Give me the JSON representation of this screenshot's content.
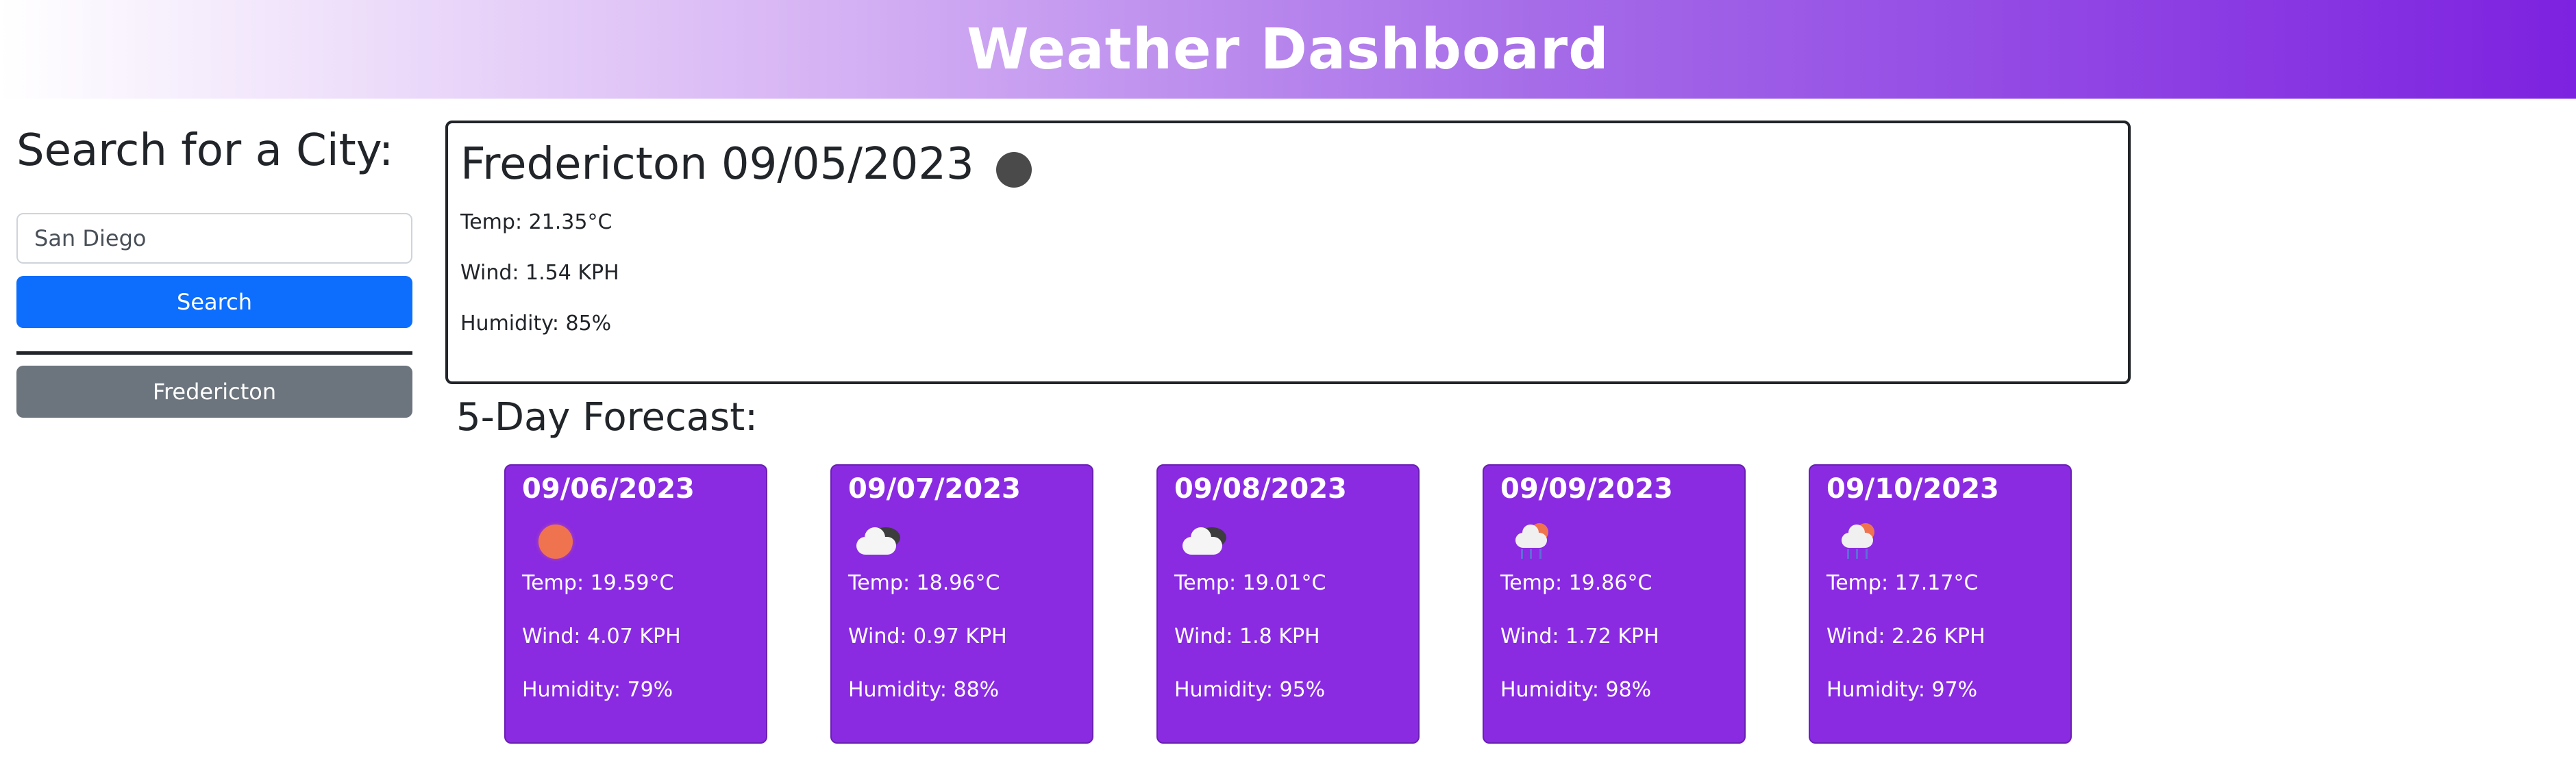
{
  "header": {
    "title": "Weather Dashboard"
  },
  "sidebar": {
    "search_title": "Search for a City:",
    "search_input_value": "San Diego",
    "search_button_label": "Search",
    "history": [
      "Fredericton"
    ]
  },
  "current": {
    "title": "Fredericton 09/05/2023",
    "icon": "overcast-cloud-icon",
    "temp": "Temp: 21.35°C",
    "wind": "Wind: 1.54 KPH",
    "humidity": "Humidity: 85%"
  },
  "forecast": {
    "title": "5-Day Forecast:",
    "days": [
      {
        "date": "09/06/2023",
        "icon": "clear-sun-icon",
        "temp": "Temp: 19.59°C",
        "wind": "Wind: 4.07 KPH",
        "humidity": "Humidity: 79%"
      },
      {
        "date": "09/07/2023",
        "icon": "broken-clouds-icon",
        "temp": "Temp: 18.96°C",
        "wind": "Wind: 0.97 KPH",
        "humidity": "Humidity: 88%"
      },
      {
        "date": "09/08/2023",
        "icon": "broken-clouds-icon",
        "temp": "Temp: 19.01°C",
        "wind": "Wind: 1.8 KPH",
        "humidity": "Humidity: 95%"
      },
      {
        "date": "09/09/2023",
        "icon": "rain-sun-icon",
        "temp": "Temp: 19.86°C",
        "wind": "Wind: 1.72 KPH",
        "humidity": "Humidity: 98%"
      },
      {
        "date": "09/10/2023",
        "icon": "rain-sun-icon",
        "temp": "Temp: 17.17°C",
        "wind": "Wind: 2.26 KPH",
        "humidity": "Humidity: 97%"
      }
    ]
  },
  "colors": {
    "header_gradient_end": "#7d22e0",
    "forecast_card": "#8a2be2",
    "search_button": "#0d6efd",
    "history_button": "#6c757d"
  }
}
